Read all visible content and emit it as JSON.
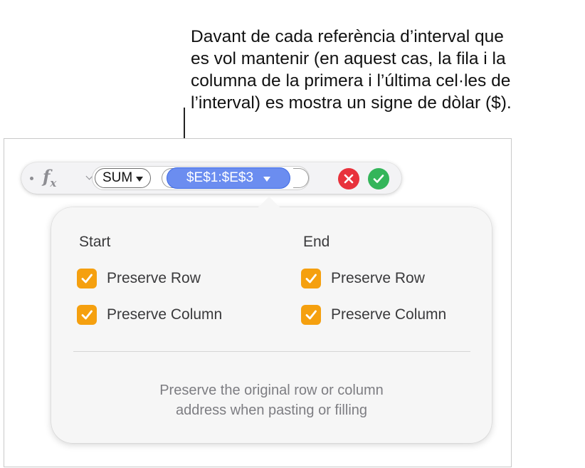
{
  "callout": {
    "lines": [
      "Davant de cada referència d’interval que",
      "es vol mantenir (en aquest cas, la fila i la",
      "columna de la primera i l’última cel·les de",
      "l’interval) es mostra un signe de dòlar ($)."
    ]
  },
  "formula_bar": {
    "fx_main": "f",
    "fx_sub": "x",
    "function_name": "SUM",
    "range_reference": "$E$1:$E$3",
    "cancel_icon": "x-mark-icon",
    "accept_icon": "checkmark-icon",
    "cancel_color": "#e8323c",
    "accept_color": "#34b55a",
    "range_color": "#6b8df0"
  },
  "popover": {
    "start": {
      "title": "Start",
      "preserve_row": {
        "label": "Preserve Row",
        "checked": true
      },
      "preserve_column": {
        "label": "Preserve Column",
        "checked": true
      }
    },
    "end": {
      "title": "End",
      "preserve_row": {
        "label": "Preserve Row",
        "checked": true
      },
      "preserve_column": {
        "label": "Preserve Column",
        "checked": true
      }
    },
    "description_lines": [
      "Preserve the original row or column",
      "address when pasting or filling"
    ],
    "checkbox_color": "#f5a00f"
  }
}
